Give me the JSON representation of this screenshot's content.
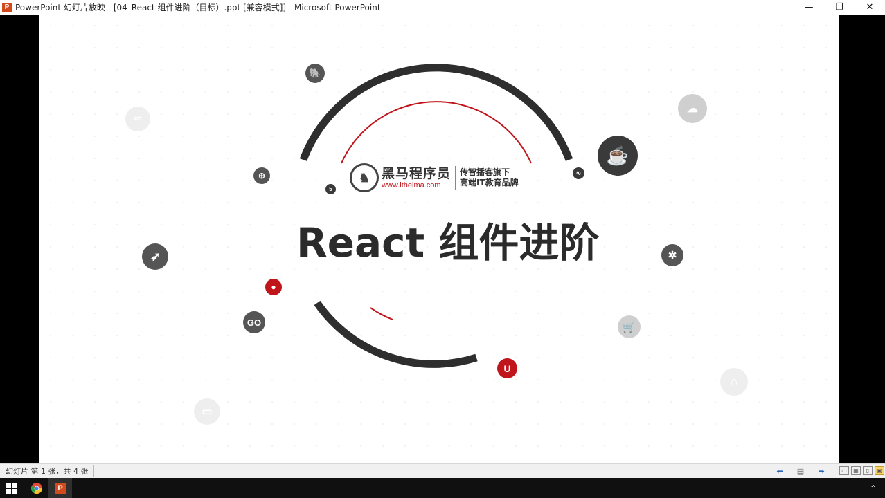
{
  "window": {
    "title": "PowerPoint 幻灯片放映 - [04_React 组件进阶（目标）.ppt [兼容模式]] - Microsoft PowerPoint",
    "app_icon_letter": "P",
    "minimize_icon": "—",
    "restore_icon": "❐",
    "close_icon": "✕"
  },
  "slide": {
    "logo": {
      "name": "黑马程序员",
      "url": "www.itheima.com",
      "tagline_1": "传智播客旗下",
      "tagline_2": "高端IT教育品牌"
    },
    "title": "React 组件进阶",
    "tech_icons": [
      "elephant-icon",
      "globe-icon",
      "html5-icon",
      "android-icon",
      "user-icon",
      "go-icon",
      "java-icon",
      "python-icon",
      "bug-icon",
      "cart-icon",
      "u-icon",
      "cloud-icon",
      "infinity-icon",
      "browser-icon",
      "store-icon"
    ],
    "go_label": "GO",
    "accent_color": "#c0151b"
  },
  "statusbar": {
    "slide_info": "幻灯片 第 1 张，共 4 张"
  },
  "taskbar": {
    "pp_letter": "P"
  }
}
